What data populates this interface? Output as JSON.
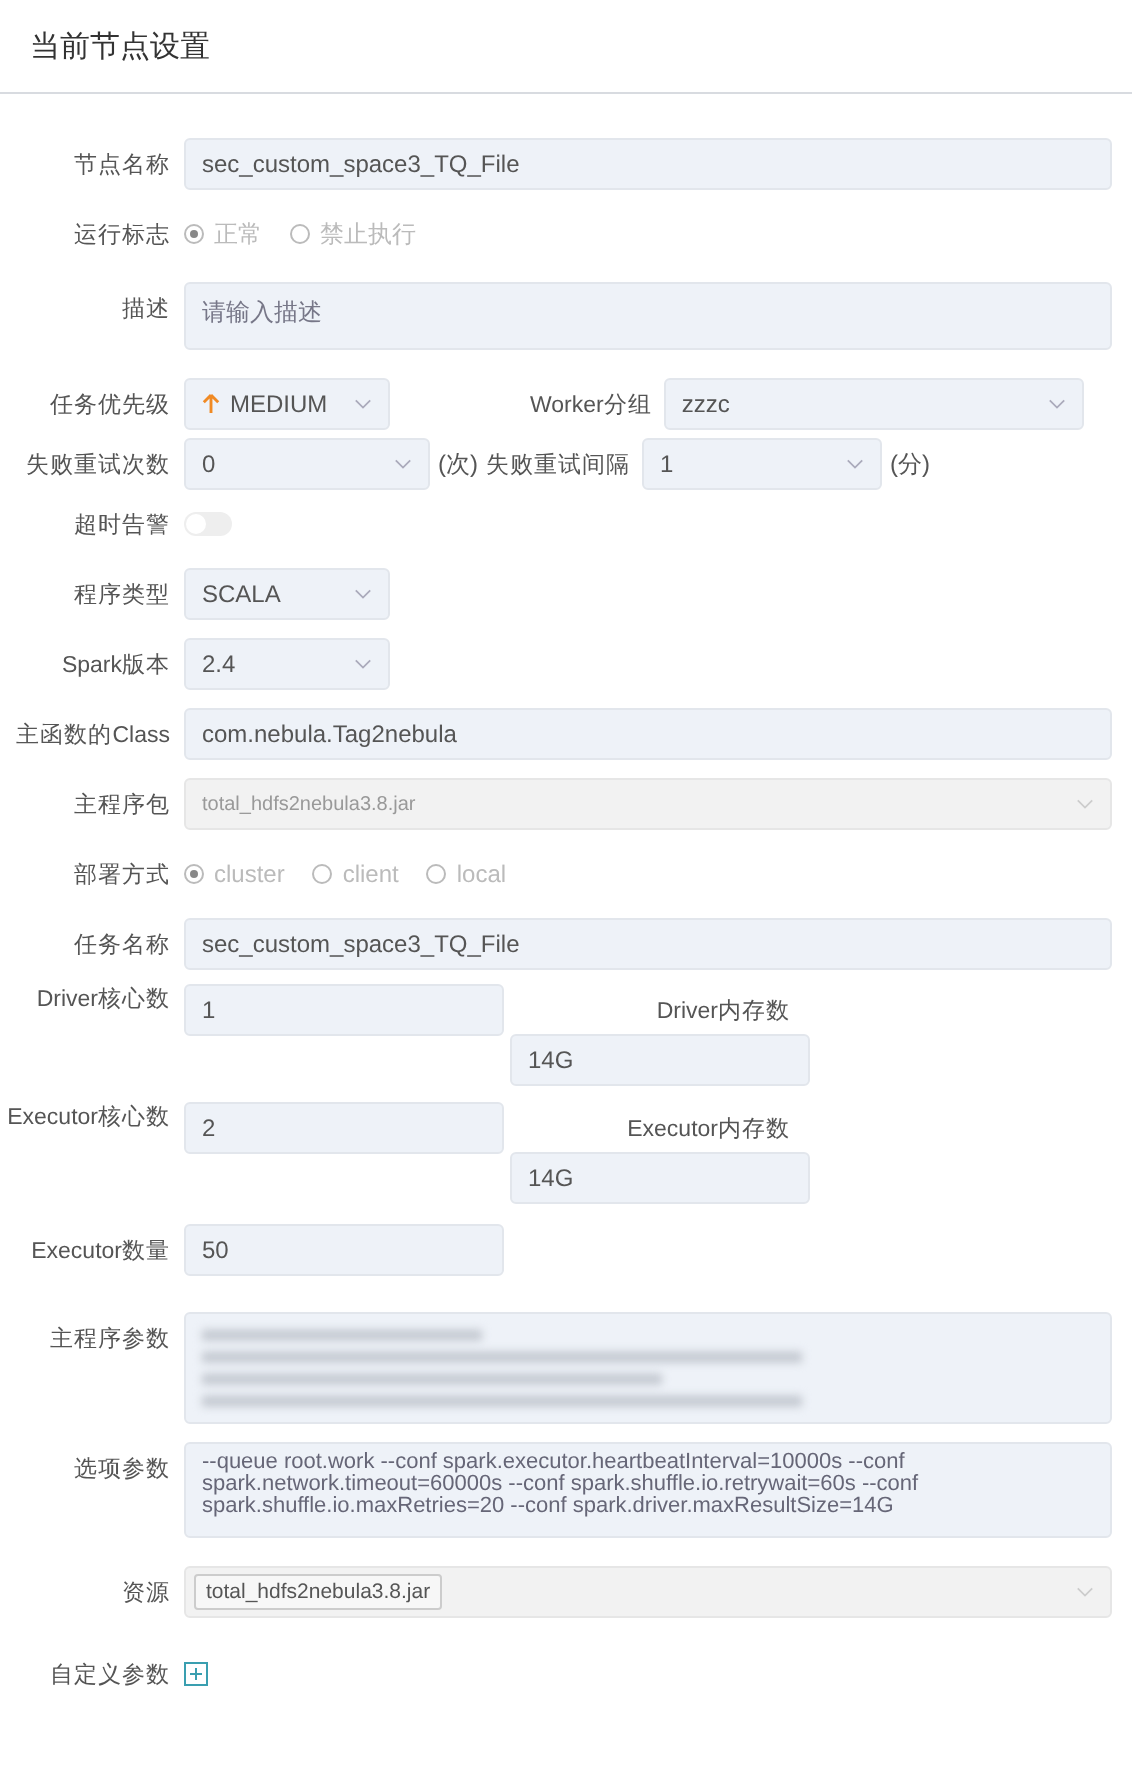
{
  "title": "当前节点设置",
  "rows": [
    {
      "kind": "input",
      "label": "节点名称",
      "value": "sec_custom_space3_TQ_File"
    },
    {
      "kind": "radio",
      "label": "运行标志",
      "disabled": true,
      "options": [
        {
          "label": "正常",
          "selected": true
        },
        {
          "label": "禁止执行",
          "selected": false
        }
      ]
    },
    {
      "kind": "textarea",
      "label": "描述",
      "placeholder": "请输入描述"
    },
    {
      "kind": "pair",
      "fields": [
        {
          "label": "任务优先级",
          "value": "MEDIUM",
          "priority": true
        },
        {
          "label": "Worker分组",
          "value": "zzzc",
          "priority": false
        }
      ]
    },
    {
      "kind": "pair",
      "fields": [
        {
          "label": "失败重试次数",
          "value": "0",
          "unit": "(次)",
          "priority": false
        },
        {
          "label": "失败重试间隔",
          "value": "1",
          "unit": "(分)",
          "priority": false
        }
      ]
    },
    {
      "kind": "switch",
      "label": "超时告警",
      "on": false
    },
    {
      "kind": "select",
      "label": "程序类型",
      "value": "SCALA"
    },
    {
      "kind": "select",
      "label": "Spark版本",
      "value": "2.4"
    },
    {
      "kind": "input",
      "label": "主函数的Class",
      "value": "com.nebula.Tag2nebula"
    },
    {
      "kind": "disabled-select",
      "label": "主程序包",
      "value": "total_hdfs2nebula3.8.jar"
    },
    {
      "kind": "radio",
      "label": "部署方式",
      "disabled": true,
      "options": [
        {
          "label": "cluster",
          "selected": true
        },
        {
          "label": "client",
          "selected": false
        },
        {
          "label": "local",
          "selected": false
        }
      ]
    },
    {
      "kind": "input",
      "label": "任务名称",
      "value": "sec_custom_space3_TQ_File"
    },
    {
      "kind": "stacked",
      "fields": [
        {
          "label": "Driver核心数",
          "value": "1"
        },
        {
          "label": "Driver内存数",
          "value": "14G"
        }
      ]
    },
    {
      "kind": "stacked",
      "fields": [
        {
          "label": "Executor核心数",
          "value": "2"
        },
        {
          "label": "Executor内存数",
          "value": "14G"
        }
      ]
    },
    {
      "kind": "short-input",
      "label": "Executor数量",
      "value": "50"
    },
    {
      "kind": "blurred",
      "label": "主程序参数"
    },
    {
      "kind": "textarea",
      "label": "选项参数",
      "value": "--queue root.work --conf spark.executor.heartbeatInterval=10000s --conf spark.network.timeout=60000s  --conf spark.shuffle.io.retrywait=60s --conf spark.shuffle.io.maxRetries=20 --conf spark.driver.maxResultSize=14G"
    },
    {
      "kind": "tags",
      "label": "资源",
      "tags": [
        "total_hdfs2nebula3.8.jar"
      ]
    },
    {
      "kind": "add",
      "label": "自定义参数"
    }
  ]
}
